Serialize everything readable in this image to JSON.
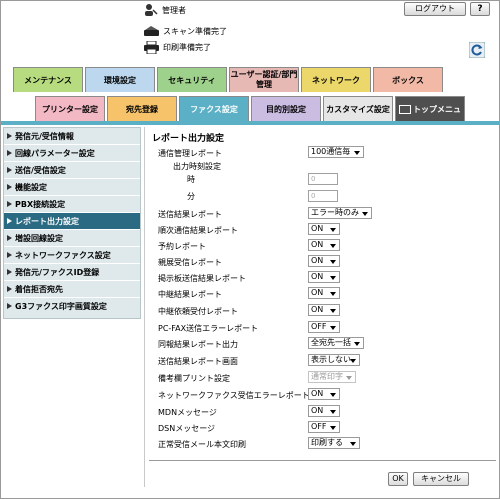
{
  "header": {
    "user_name": "管理者",
    "logout_label": "ログアウト",
    "help_label": "?",
    "status": [
      "スキャン準備完了",
      "印刷準備完了"
    ]
  },
  "tabs_row1": [
    {
      "label": "メンテナンス",
      "color": "#b7dc80"
    },
    {
      "label": "環境設定",
      "color": "#bdd8ee"
    },
    {
      "label": "セキュリティ",
      "color": "#9ed18c"
    },
    {
      "label": "ユーザー認証/部門管理",
      "color": "#e7b9b5"
    },
    {
      "label": "ネットワーク",
      "color": "#ecd86a"
    },
    {
      "label": "ボックス",
      "color": "#f2b9a6"
    }
  ],
  "tabs_row2": [
    {
      "label": "プリンター設定",
      "color": "#f2b8c4"
    },
    {
      "label": "宛先登録",
      "color": "#f6c36b"
    },
    {
      "label": "ファクス設定",
      "color": "#5bb0c6",
      "active": true
    },
    {
      "label": "目的別設定",
      "color": "#cbbce2"
    },
    {
      "label": "カスタマイズ設定",
      "color": "#e6e6e6"
    },
    {
      "label": "トップメニューへ",
      "color": "#4f4f4f"
    }
  ],
  "sidebar": [
    "発信元/受信情報",
    "回線パラメーター設定",
    "送信/受信設定",
    "機能設定",
    "PBX接続設定",
    "レポート出力設定",
    "増設回線設定",
    "ネットワークファクス設定",
    "発信元/ファクスID登録",
    "着信拒否宛先",
    "G3ファクス印字画質設定"
  ],
  "active_sidebar_index": 5,
  "content": {
    "title": "レポート出力設定",
    "comm_report_label": "通信管理レポート",
    "comm_report_value": "100通信毎",
    "output_time_label": "出力時刻設定",
    "hour_label": "時",
    "hour_value": "0",
    "minute_label": "分",
    "minute_value": "0",
    "rows": [
      {
        "label": "送信結果レポート",
        "value": "エラー時のみ"
      },
      {
        "label": "順次通信結果レポート",
        "value": "ON"
      },
      {
        "label": "予約レポート",
        "value": "ON"
      },
      {
        "label": "親展受信レポート",
        "value": "ON"
      },
      {
        "label": "掲示板送信結果レポート",
        "value": "ON"
      },
      {
        "label": "中継結果レポート",
        "value": "ON"
      },
      {
        "label": "中継依頼受付レポート",
        "value": "ON"
      },
      {
        "label": "PC-FAX送信エラーレポート",
        "value": "OFF"
      },
      {
        "label": "同報結果レポート出力",
        "value": "全宛先一括"
      },
      {
        "label": "送信結果レポート画面",
        "value": "表示しない"
      },
      {
        "label": "備考欄プリント設定",
        "value": "通常印字",
        "disabled": true
      },
      {
        "label": "ネットワークファクス受信エラーレポート",
        "value": "ON"
      },
      {
        "label": "MDNメッセージ",
        "value": "ON"
      },
      {
        "label": "DSNメッセージ",
        "value": "OFF"
      },
      {
        "label": "正常受信メール本文印刷",
        "value": "印刷する"
      }
    ]
  },
  "footer": {
    "ok_label": "OK",
    "cancel_label": "キャンセル"
  }
}
